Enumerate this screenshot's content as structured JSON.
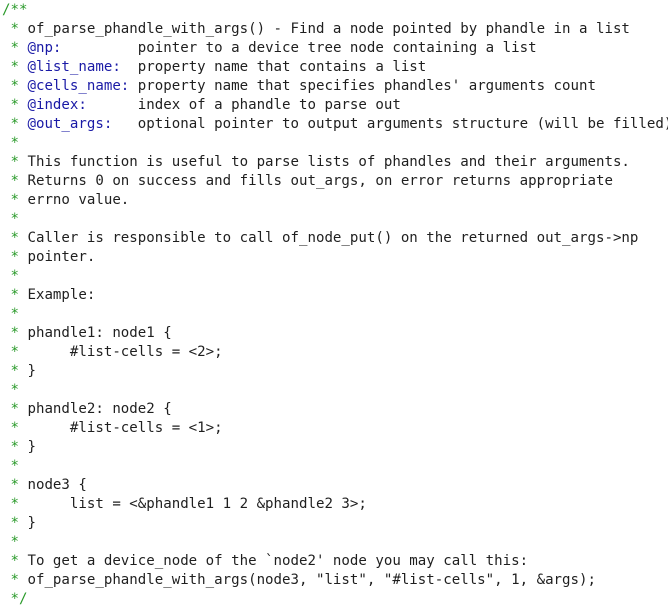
{
  "colors": {
    "comment_marker": "#2a9a2a",
    "doc_tag": "#1a1aa6",
    "text": "#1f1f1f",
    "background": "#ffffff"
  },
  "lines": [
    {
      "marker": "/**",
      "tag": "",
      "text": ""
    },
    {
      "marker": " *",
      "tag": "",
      "text": " of_parse_phandle_with_args() - Find a node pointed by phandle in a list"
    },
    {
      "marker": " *",
      "tag": " @np:",
      "text": "         pointer to a device tree node containing a list"
    },
    {
      "marker": " *",
      "tag": " @list_name:",
      "text": "  property name that contains a list"
    },
    {
      "marker": " *",
      "tag": " @cells_name:",
      "text": " property name that specifies phandles' arguments count"
    },
    {
      "marker": " *",
      "tag": " @index:",
      "text": "      index of a phandle to parse out"
    },
    {
      "marker": " *",
      "tag": " @out_args:",
      "text": "   optional pointer to output arguments structure (will be filled)"
    },
    {
      "marker": " *",
      "tag": "",
      "text": ""
    },
    {
      "marker": " *",
      "tag": "",
      "text": " This function is useful to parse lists of phandles and their arguments."
    },
    {
      "marker": " *",
      "tag": "",
      "text": " Returns 0 on success and fills out_args, on error returns appropriate"
    },
    {
      "marker": " *",
      "tag": "",
      "text": " errno value."
    },
    {
      "marker": " *",
      "tag": "",
      "text": ""
    },
    {
      "marker": " *",
      "tag": "",
      "text": " Caller is responsible to call of_node_put() on the returned out_args->np"
    },
    {
      "marker": " *",
      "tag": "",
      "text": " pointer."
    },
    {
      "marker": " *",
      "tag": "",
      "text": ""
    },
    {
      "marker": " *",
      "tag": "",
      "text": " Example:"
    },
    {
      "marker": " *",
      "tag": "",
      "text": ""
    },
    {
      "marker": " *",
      "tag": "",
      "text": " phandle1: node1 {"
    },
    {
      "marker": " *",
      "tag": "",
      "text": " \t#list-cells = <2>;"
    },
    {
      "marker": " *",
      "tag": "",
      "text": " }"
    },
    {
      "marker": " *",
      "tag": "",
      "text": ""
    },
    {
      "marker": " *",
      "tag": "",
      "text": " phandle2: node2 {"
    },
    {
      "marker": " *",
      "tag": "",
      "text": " \t#list-cells = <1>;"
    },
    {
      "marker": " *",
      "tag": "",
      "text": " }"
    },
    {
      "marker": " *",
      "tag": "",
      "text": ""
    },
    {
      "marker": " *",
      "tag": "",
      "text": " node3 {"
    },
    {
      "marker": " *",
      "tag": "",
      "text": " \tlist = <&phandle1 1 2 &phandle2 3>;"
    },
    {
      "marker": " *",
      "tag": "",
      "text": " }"
    },
    {
      "marker": " *",
      "tag": "",
      "text": ""
    },
    {
      "marker": " *",
      "tag": "",
      "text": " To get a device_node of the `node2' node you may call this:"
    },
    {
      "marker": " *",
      "tag": "",
      "text": " of_parse_phandle_with_args(node3, \"list\", \"#list-cells\", 1, &args);"
    },
    {
      "marker": " */",
      "tag": "",
      "text": ""
    }
  ]
}
